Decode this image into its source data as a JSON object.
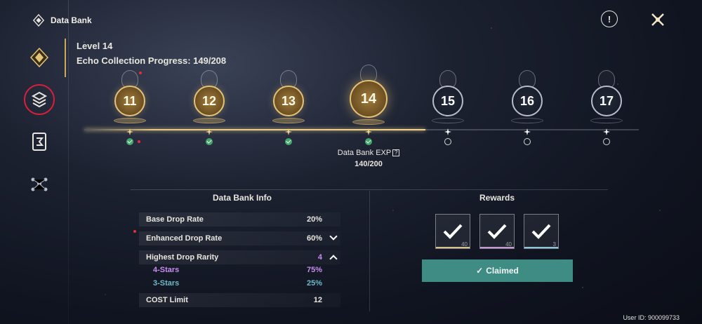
{
  "header": {
    "title": "Data Bank"
  },
  "level": {
    "label": "Level 14",
    "progress": "Echo Collection Progress: 149/208"
  },
  "track": {
    "nodes": [
      {
        "num": "11",
        "state": "gold",
        "claimed": true
      },
      {
        "num": "12",
        "state": "gold",
        "claimed": true
      },
      {
        "num": "13",
        "state": "gold",
        "claimed": true
      },
      {
        "num": "14",
        "state": "gold-current",
        "claimed": true
      },
      {
        "num": "15",
        "state": "dark",
        "claimed": false
      },
      {
        "num": "16",
        "state": "dark",
        "claimed": false
      },
      {
        "num": "17",
        "state": "dark",
        "claimed": false
      }
    ],
    "progress_fraction": 0.615
  },
  "exp": {
    "label": "Data Bank EXP",
    "help": "?",
    "value": "140/200"
  },
  "info_panel": {
    "title": "Data Bank Info",
    "base_drop": {
      "label": "Base Drop Rate",
      "value": "20%"
    },
    "enhanced_drop": {
      "label": "Enhanced Drop Rate",
      "value": "60%"
    },
    "highest_rarity": {
      "label": "Highest Drop Rarity",
      "value": "4"
    },
    "four_stars": {
      "label": "4-Stars",
      "value": "75%"
    },
    "three_stars": {
      "label": "3-Stars",
      "value": "25%"
    },
    "cost_limit": {
      "label": "COST Limit",
      "value": "12"
    }
  },
  "rewards_panel": {
    "title": "Rewards",
    "items": [
      {
        "count": "40",
        "color": "#d6c38a"
      },
      {
        "count": "40",
        "color": "#c79ad6"
      },
      {
        "count": "3",
        "color": "#8fc4d9"
      }
    ],
    "claim_label": "Claimed"
  },
  "footer": {
    "user_id": "User ID: 900099733"
  },
  "colors": {
    "gold": "#e4c277",
    "purple": "#c88df0",
    "teal": "#6fb9c9",
    "button": "#3f8c84"
  }
}
